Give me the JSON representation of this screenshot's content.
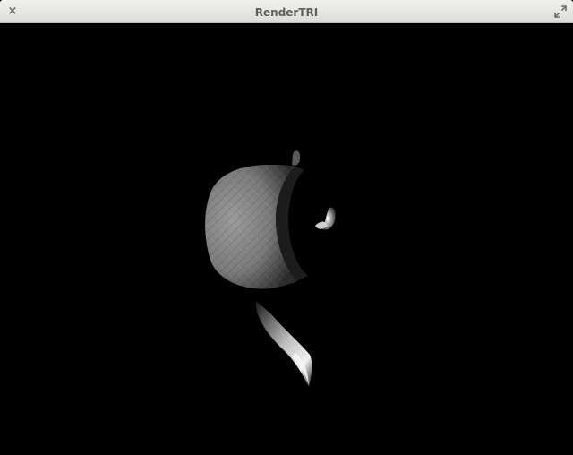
{
  "window": {
    "title": "RenderTRI",
    "close_glyph": "×",
    "close_icon": "close-icon",
    "maximize_icon": "maximize-icon"
  },
  "scene": {
    "background_color": "#000000",
    "model_color": "#8a8a8a"
  }
}
